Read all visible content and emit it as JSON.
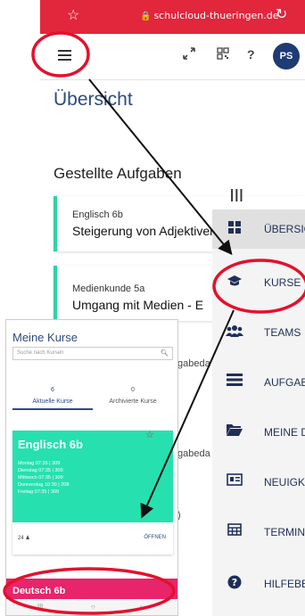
{
  "browser": {
    "url": "schulcloud-thueringen.de",
    "star_glyph": "☆",
    "lock_glyph": "🔒",
    "reload_glyph": "↻"
  },
  "header": {
    "avatar_initials": "PS",
    "help_label": "?"
  },
  "main": {
    "page_title": "Übersicht",
    "section_title": "Gestellte Aufgaben",
    "tasks": [
      {
        "course": "Englisch 6b",
        "task": "Steigerung von Adjektiven"
      },
      {
        "course": "Medienkunde 5a",
        "task": "Umgang mit Medien - E"
      }
    ],
    "fragments": [
      "gabeda",
      "gabeda",
      ")"
    ]
  },
  "sidebar": {
    "collapse_label": "|||",
    "items": [
      {
        "label": "ÜBERSICHT",
        "icon": "dashboard-icon",
        "active": true
      },
      {
        "label": "KURSE",
        "icon": "graduation-cap-icon",
        "active": false
      },
      {
        "label": "TEAMS",
        "icon": "users-icon",
        "active": false
      },
      {
        "label": "AUFGABEN",
        "icon": "tasks-icon",
        "active": false
      },
      {
        "label": "MEINE DATEIEN",
        "icon": "folder-icon",
        "active": false
      },
      {
        "label": "NEUIGKEITEN",
        "icon": "news-icon",
        "active": false
      },
      {
        "label": "TERMINE",
        "icon": "calendar-icon",
        "active": false
      },
      {
        "label": "HILFEBEREICH",
        "icon": "help-icon",
        "active": false
      }
    ]
  },
  "phone": {
    "title": "Meine Kurse",
    "search_placeholder": "Suche nach Kursen",
    "tabs": [
      {
        "count": "6",
        "label": "Aktuelle Kurse",
        "active": true
      },
      {
        "count": "0",
        "label": "Archivierte Kurse",
        "active": false
      }
    ],
    "course": {
      "name": "Englisch 6b",
      "schedule": [
        "Montag 07:35 | 309",
        "Dienstag 07:35 | 309",
        "Mittwoch 07:35 | 309",
        "Donnerstag 10:30 | 208",
        "Freitag 07:35 | 309"
      ],
      "members": "24",
      "open_label": "ÖFFNEN"
    },
    "second_course": "Deutsch 6b"
  },
  "colors": {
    "brand_red": "#e2263c",
    "navy": "#1f2f57",
    "teal": "#26e0b0",
    "pink": "#e8246a",
    "annotation_red": "#e3112c"
  }
}
